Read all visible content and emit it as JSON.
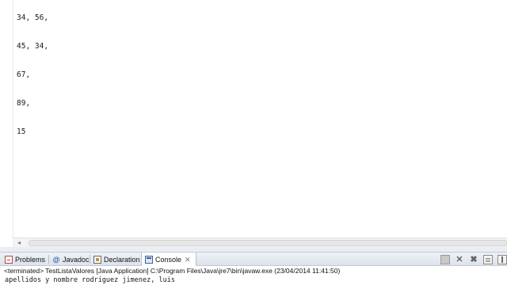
{
  "editor": {
    "lines": [
      "34, 56,",
      "45, 34,",
      "67,",
      "89,",
      "15"
    ]
  },
  "console_view": {
    "tabs": [
      {
        "label": "Problems"
      },
      {
        "label": "Javadoc"
      },
      {
        "label": "Declaration"
      },
      {
        "label": "Console",
        "active": true
      }
    ],
    "close_glyph": "✕",
    "status": "<terminated> TestListaValores [Java Application] C:\\Program Files\\Java\\jre7\\bin\\javaw.exe (23/04/2014 11:41:50)",
    "output": "apellidos y nombre rodriguez jimenez, luis"
  },
  "icons": {
    "problems": "problems-icon",
    "javadoc": "javadoc-icon",
    "declaration": "declaration-icon",
    "console": "console-icon",
    "terminate": "stop-icon",
    "remove_launch": "remove-launch-icon",
    "remove_all": "remove-all-icon",
    "clear_console": "clear-console-icon",
    "scroll_lock": "scroll-lock-icon",
    "scroll_left": "chevron-left-icon"
  },
  "colors": {
    "tab_bar": "#dde3eb",
    "active_tab": "#ffffff",
    "editor_bg": "#ffffff"
  }
}
